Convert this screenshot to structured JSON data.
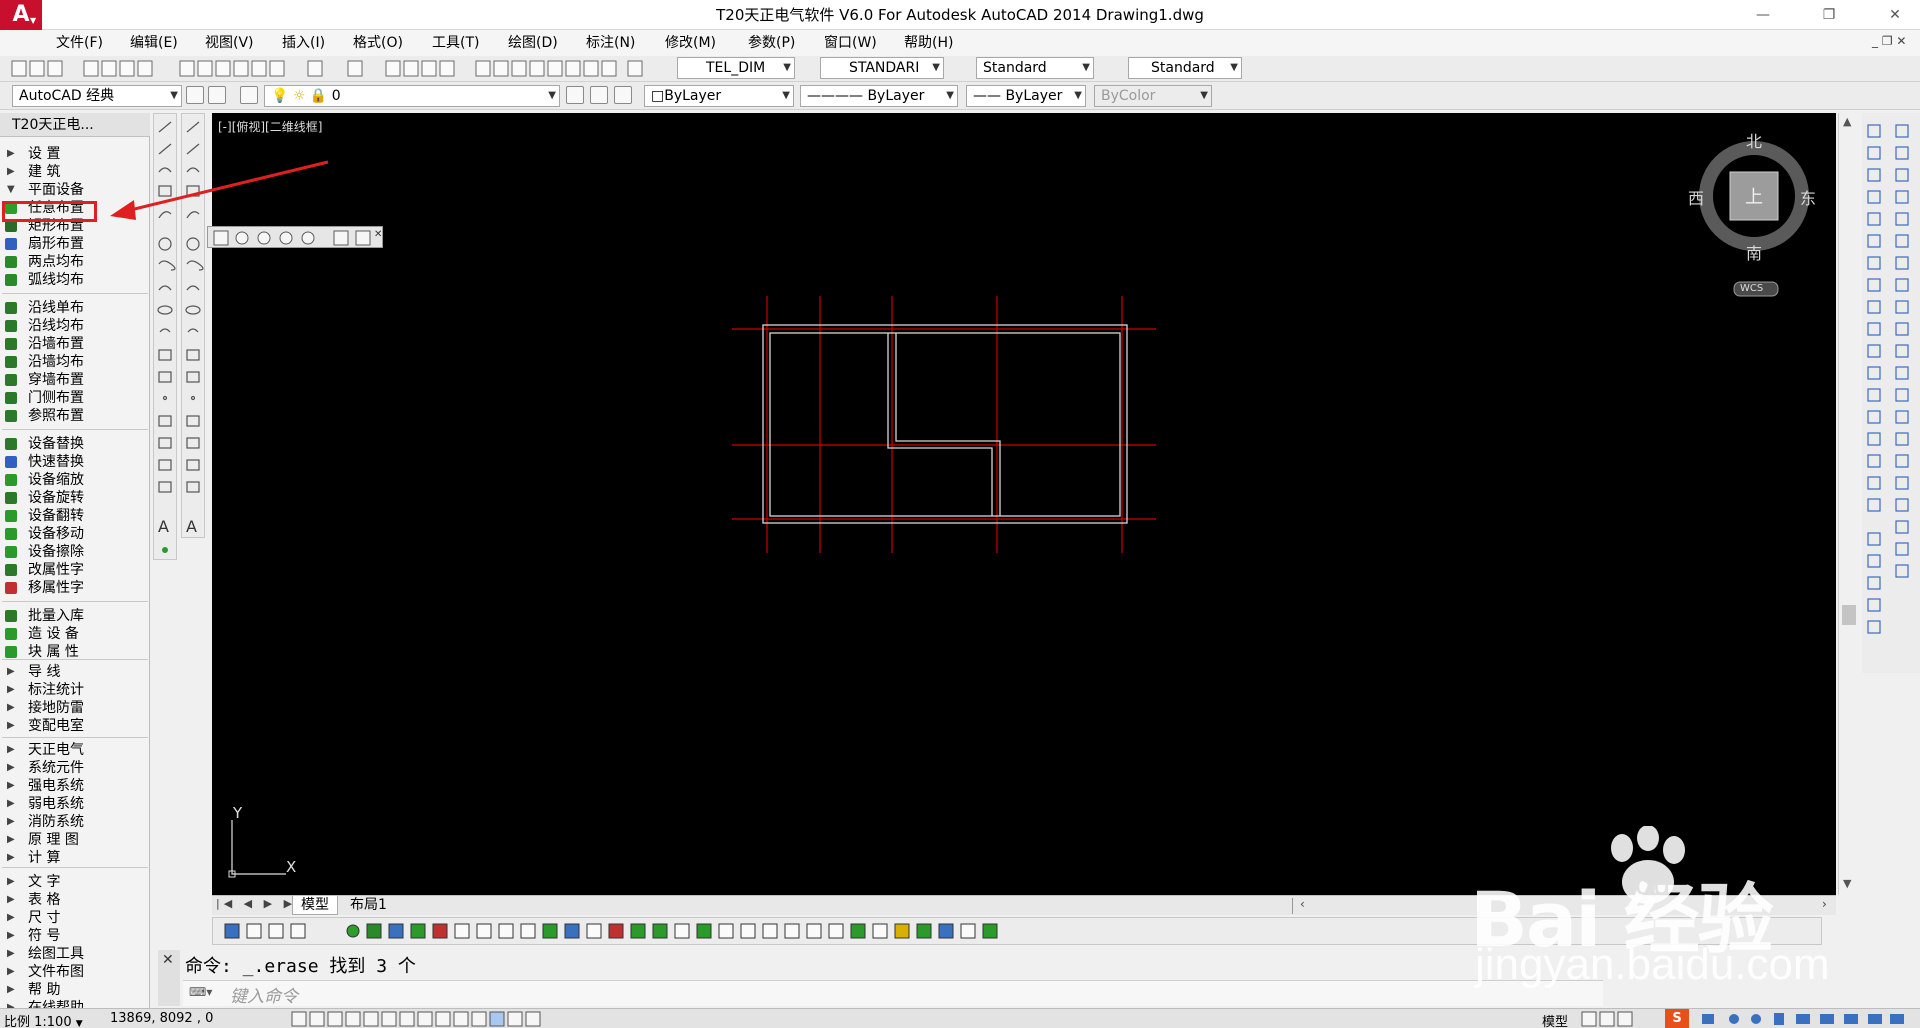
{
  "window": {
    "title": "T20天正电气软件 V6.0 For Autodesk AutoCAD 2014    Drawing1.dwg",
    "app_logo": "A"
  },
  "menu": [
    "文件(F)",
    "编辑(E)",
    "视图(V)",
    "插入(I)",
    "格式(O)",
    "工具(T)",
    "绘图(D)",
    "标注(N)",
    "修改(M)",
    "参数(P)",
    "窗口(W)",
    "帮助(H)"
  ],
  "toolbar": {
    "dim_style": "TEL_DIM",
    "text_style": "STANDARI",
    "table_style": "Standard",
    "multileader_style": "Standard",
    "workspace": "AutoCAD 经典",
    "layer": "0",
    "color": "ByLayer",
    "linetype": "ByLayer",
    "lineweight": "ByLayer",
    "plotstyle": "ByColor"
  },
  "palette": {
    "title": "T20天正电...",
    "items": [
      {
        "label": "设    置",
        "kind": "folder"
      },
      {
        "label": "建    筑",
        "kind": "folder"
      },
      {
        "label": "平面设备",
        "kind": "folder-open"
      },
      {
        "label": "任意布置",
        "kind": "cmd",
        "color": "#2aa02a",
        "highlight": true
      },
      {
        "label": "矩形布置",
        "kind": "cmd",
        "color": "#2a6a2a"
      },
      {
        "label": "扇形布置",
        "kind": "cmd",
        "color": "#3060c0"
      },
      {
        "label": "两点均布",
        "kind": "cmd",
        "color": "#2a8a2a"
      },
      {
        "label": "弧线均布",
        "kind": "cmd",
        "color": "#2a8a2a"
      },
      {
        "label": "沿线单布",
        "kind": "cmd",
        "color": "#2a7a2a"
      },
      {
        "label": "沿线均布",
        "kind": "cmd",
        "color": "#2a7a2a"
      },
      {
        "label": "沿墙布置",
        "kind": "cmd",
        "color": "#2a7a2a"
      },
      {
        "label": "沿墙均布",
        "kind": "cmd",
        "color": "#2a7a2a"
      },
      {
        "label": "穿墙布置",
        "kind": "cmd",
        "color": "#2a7a2a"
      },
      {
        "label": "门侧布置",
        "kind": "cmd",
        "color": "#2a7a2a"
      },
      {
        "label": "参照布置",
        "kind": "cmd",
        "color": "#2a7a2a"
      },
      {
        "label": "设备替换",
        "kind": "cmd",
        "color": "#2a7a2a"
      },
      {
        "label": "快速替换",
        "kind": "cmd",
        "color": "#3060c0"
      },
      {
        "label": "设备缩放",
        "kind": "cmd",
        "color": "#2a9a2a"
      },
      {
        "label": "设备旋转",
        "kind": "cmd",
        "color": "#2a7a2a"
      },
      {
        "label": "设备翻转",
        "kind": "cmd",
        "color": "#2a9a2a"
      },
      {
        "label": "设备移动",
        "kind": "cmd",
        "color": "#2a9a2a"
      },
      {
        "label": "设备擦除",
        "kind": "cmd",
        "color": "#2a9a2a"
      },
      {
        "label": "改属性字",
        "kind": "cmd",
        "color": "#2a7a2a"
      },
      {
        "label": "移属性字",
        "kind": "cmd",
        "color": "#c03030"
      },
      {
        "label": "批量入库",
        "kind": "cmd",
        "color": "#2a7a2a"
      },
      {
        "label": "造 设 备",
        "kind": "cmd",
        "color": "#2a9a2a"
      },
      {
        "label": "块 属 性",
        "kind": "cmd",
        "color": "#2a9a2a"
      },
      {
        "label": "导    线",
        "kind": "folder"
      },
      {
        "label": "标注统计",
        "kind": "folder"
      },
      {
        "label": "接地防雷",
        "kind": "folder"
      },
      {
        "label": "变配电室",
        "kind": "folder"
      },
      {
        "label": "天正电气",
        "kind": "folder"
      },
      {
        "label": "系统元件",
        "kind": "folder"
      },
      {
        "label": "强电系统",
        "kind": "folder"
      },
      {
        "label": "弱电系统",
        "kind": "folder"
      },
      {
        "label": "消防系统",
        "kind": "folder"
      },
      {
        "label": "原 理 图",
        "kind": "folder"
      },
      {
        "label": "计    算",
        "kind": "folder"
      },
      {
        "label": "文    字",
        "kind": "folder"
      },
      {
        "label": "表    格",
        "kind": "folder"
      },
      {
        "label": "尺    寸",
        "kind": "folder"
      },
      {
        "label": "符    号",
        "kind": "folder"
      },
      {
        "label": "绘图工具",
        "kind": "folder"
      },
      {
        "label": "文件布图",
        "kind": "folder"
      },
      {
        "label": "帮    助",
        "kind": "folder"
      },
      {
        "label": "在线帮助",
        "kind": "folder"
      }
    ]
  },
  "viewport": {
    "label": "[-][俯视][二维线框]",
    "compass": {
      "north": "北",
      "south": "南",
      "east": "东",
      "west": "西",
      "top": "上"
    },
    "wcs": "WCS",
    "ucs_x": "X",
    "ucs_y": "Y"
  },
  "tabs": [
    "模型",
    "布局1"
  ],
  "command": {
    "history": "命令:  _.erase 找到 3 个",
    "placeholder": "键入命令"
  },
  "status": {
    "scale": "比例 1:100",
    "coords": "13869, 8092 , 0",
    "model": "模型"
  },
  "watermark": {
    "brand": "Bai 经验",
    "url": "jingyan.baidu.com"
  },
  "colors": {
    "canvas_bg": "#000000",
    "grid_line": "#cc0000",
    "wall_line": "#d8d8d8",
    "highlight": "#e02020"
  }
}
